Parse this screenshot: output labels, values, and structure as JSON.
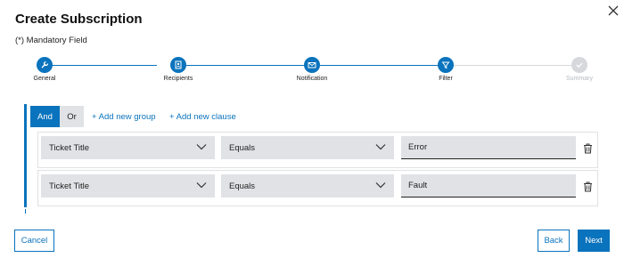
{
  "dialog": {
    "title": "Create Subscription",
    "mandatory_note": "(*) Mandatory Field"
  },
  "colors": {
    "accent": "#0a73bd",
    "step_inactive": "#d6d8db",
    "step_inactive_text": "#b6b9bd",
    "field_bg": "#e0e2e5"
  },
  "stepper": {
    "steps": [
      {
        "label": "General",
        "icon": "wrench-icon",
        "state": "completed"
      },
      {
        "label": "Recipients",
        "icon": "contact-icon",
        "state": "completed"
      },
      {
        "label": "Notification",
        "icon": "envelope-icon",
        "state": "completed"
      },
      {
        "label": "Filter",
        "icon": "funnel-icon",
        "state": "active"
      },
      {
        "label": "Summary",
        "icon": "checkmark-icon",
        "state": "disabled"
      }
    ]
  },
  "builder": {
    "operator_and": "And",
    "operator_or": "Or",
    "selected_operator": "And",
    "add_group": "+ Add new group",
    "add_clause": "+ Add new clause",
    "rules": [
      {
        "field": "Ticket Title",
        "condition": "Equals",
        "value": "Error"
      },
      {
        "field": "Ticket Title",
        "condition": "Equals",
        "value": "Fault"
      }
    ]
  },
  "footer": {
    "cancel": "Cancel",
    "back": "Back",
    "next": "Next"
  }
}
